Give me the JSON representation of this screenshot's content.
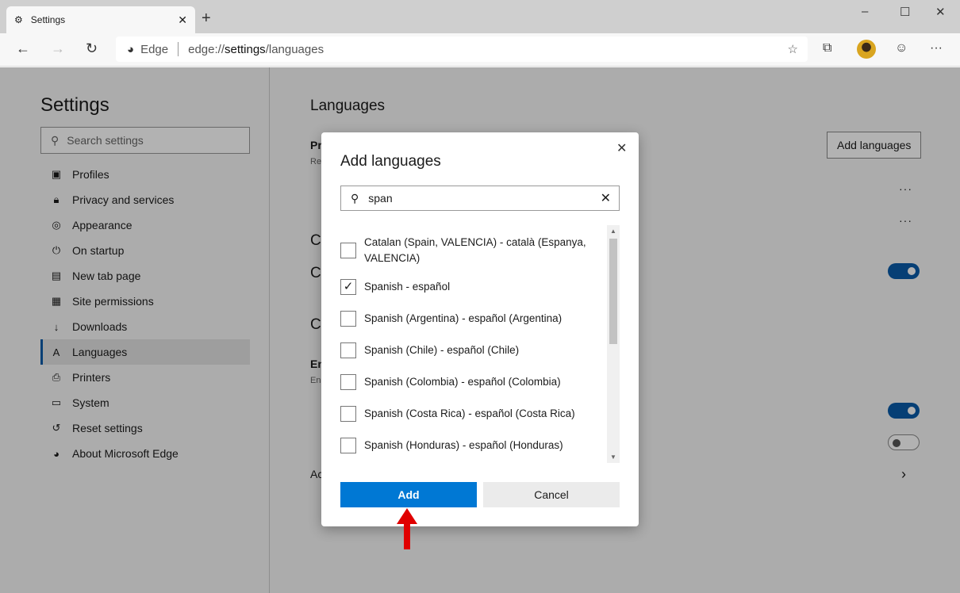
{
  "browser": {
    "tab_title": "Settings",
    "address_prefix": "Edge",
    "url_scheme": "edge://",
    "url_host": "settings",
    "url_path": "/languages"
  },
  "sidebar": {
    "title": "Settings",
    "search_placeholder": "Search settings",
    "items": [
      {
        "label": "Profiles",
        "icon": "profile-icon"
      },
      {
        "label": "Privacy and services",
        "icon": "lock-icon"
      },
      {
        "label": "Appearance",
        "icon": "palette-icon"
      },
      {
        "label": "On startup",
        "icon": "power-icon"
      },
      {
        "label": "New tab page",
        "icon": "newtab-icon"
      },
      {
        "label": "Site permissions",
        "icon": "site-permissions-icon"
      },
      {
        "label": "Downloads",
        "icon": "download-icon"
      },
      {
        "label": "Languages",
        "icon": "languages-icon",
        "selected": true
      },
      {
        "label": "Printers",
        "icon": "printer-icon"
      },
      {
        "label": "System",
        "icon": "laptop-icon"
      },
      {
        "label": "Reset settings",
        "icon": "reset-icon"
      },
      {
        "label": "About Microsoft Edge",
        "icon": "edge-icon"
      }
    ]
  },
  "main": {
    "title": "Languages",
    "add_languages_label": "Add languages",
    "fragments": [
      "Pr",
      "Re",
      "C",
      "C",
      "C",
      "En",
      "En",
      "Ac"
    ],
    "toggles": [
      true,
      true,
      false
    ]
  },
  "dialog": {
    "title": "Add languages",
    "search_value": "span",
    "items": [
      {
        "label": "Catalan (Spain, VALENCIA) - català (Espanya, VALENCIA)",
        "checked": false
      },
      {
        "label": "Spanish - español",
        "checked": true
      },
      {
        "label": "Spanish (Argentina) - español (Argentina)",
        "checked": false
      },
      {
        "label": "Spanish (Chile) - español (Chile)",
        "checked": false
      },
      {
        "label": "Spanish (Colombia) - español (Colombia)",
        "checked": false
      },
      {
        "label": "Spanish (Costa Rica) - español (Costa Rica)",
        "checked": false
      },
      {
        "label": "Spanish (Honduras) - español (Honduras)",
        "checked": false
      }
    ],
    "add_label": "Add",
    "cancel_label": "Cancel"
  },
  "colors": {
    "accent": "#0078d4",
    "annotation_arrow": "#e00000"
  }
}
